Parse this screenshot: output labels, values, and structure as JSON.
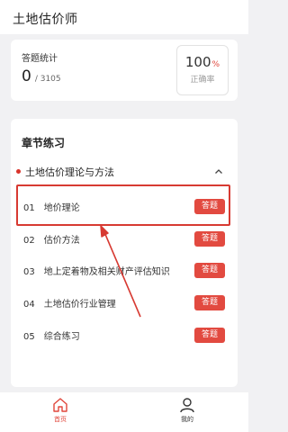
{
  "app": {
    "title": "土地估价师"
  },
  "stats": {
    "label": "答题统计",
    "answered": "0",
    "total": "/ 3105",
    "accuracy_value": "100",
    "accuracy_unit": "%",
    "accuracy_label": "正确率"
  },
  "chapters": {
    "section_title": "章节练习",
    "group_title": "土地估价理论与方法",
    "lessons": [
      {
        "label": "01　地价理论",
        "button": "答题"
      },
      {
        "label": "02　估价方法",
        "button": "答题"
      },
      {
        "label": "03　地上定着物及相关财产评估知识",
        "button": "答题"
      },
      {
        "label": "04　土地估价行业管理",
        "button": "答题"
      },
      {
        "label": "05　综合练习",
        "button": "答题"
      }
    ]
  },
  "nav": {
    "home_label": "首页",
    "mine_label": "我的",
    "active_color": "#e0463b"
  },
  "colors": {
    "accent": "#e24a40",
    "annotation": "#d73a32"
  },
  "icons": {
    "home": "home-icon",
    "mine": "user-icon",
    "chevron": "chevron-up-icon"
  }
}
